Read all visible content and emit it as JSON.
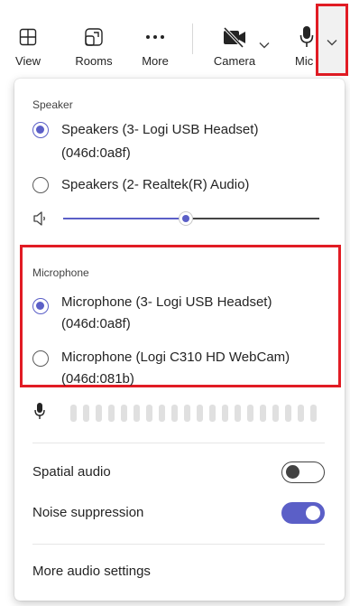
{
  "toolbar": {
    "view_label": "View",
    "rooms_label": "Rooms",
    "more_label": "More",
    "camera_label": "Camera",
    "mic_label": "Mic",
    "camera_state": "off"
  },
  "speaker": {
    "caption": "Speaker",
    "options": [
      {
        "label_line1": "Speakers (3- Logi USB Headset)",
        "label_line2": "(046d:0a8f)",
        "selected": true
      },
      {
        "label_line1": "Speakers (2- Realtek(R) Audio)",
        "label_line2": "",
        "selected": false
      }
    ],
    "volume_fraction": 0.48
  },
  "microphone": {
    "caption": "Microphone",
    "options": [
      {
        "label_line1": "Microphone (3- Logi USB Headset)",
        "label_line2": "(046d:0a8f)",
        "selected": true
      },
      {
        "label_line1": "Microphone (Logi C310 HD WebCam)",
        "label_line2": "(046d:081b)",
        "selected": false
      }
    ],
    "input_level_fraction": 0
  },
  "settings": {
    "spatial_audio_label": "Spatial audio",
    "spatial_audio_on": false,
    "noise_suppression_label": "Noise suppression",
    "noise_suppression_on": true,
    "more_audio_settings_label": "More audio settings"
  },
  "colors": {
    "accent": "#5b5fc7",
    "highlight_border": "#e11c24"
  },
  "icons": [
    "grid-view-icon",
    "rooms-icon",
    "more-icon",
    "camera-off-icon",
    "chevron-down-icon",
    "microphone-icon",
    "speaker-volume-icon"
  ]
}
